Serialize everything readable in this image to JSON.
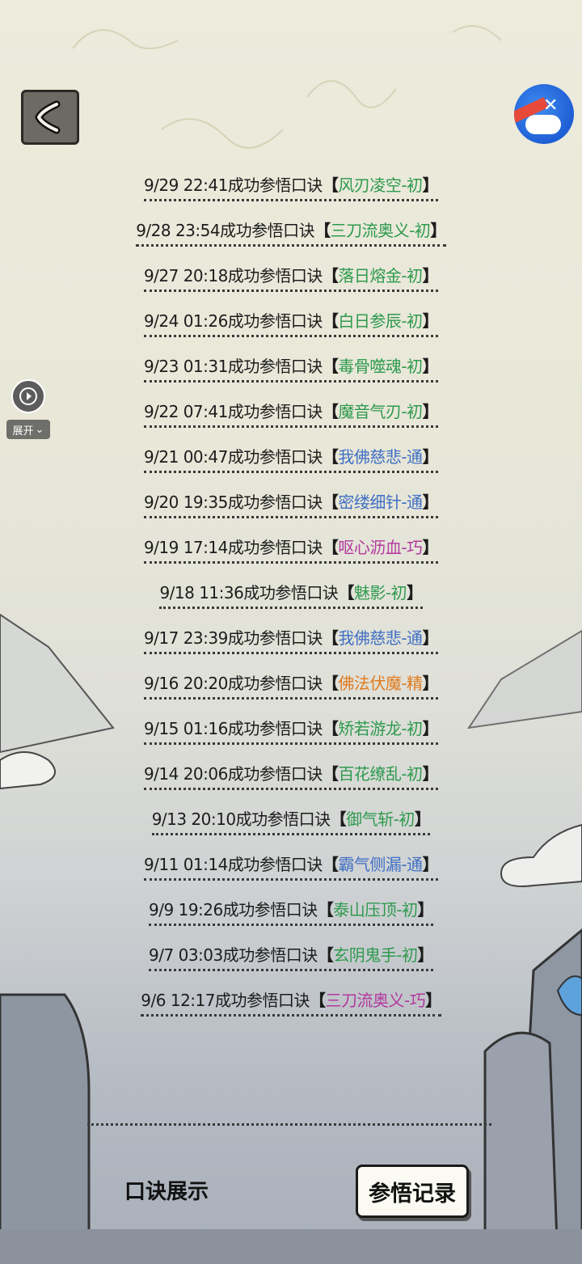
{
  "floating": {
    "expand_label": "展开"
  },
  "records": [
    {
      "time": "9/29 22:41",
      "action": "成功参悟口诀",
      "skill": "风刃凌空-初",
      "color": "#2e9a4e"
    },
    {
      "time": "9/28 23:54",
      "action": "成功参悟口诀",
      "skill": "三刀流奥义-初",
      "color": "#2e9a4e"
    },
    {
      "time": "9/27 20:18",
      "action": "成功参悟口诀",
      "skill": "落日熔金-初",
      "color": "#2e9a4e"
    },
    {
      "time": "9/24 01:26",
      "action": "成功参悟口诀",
      "skill": "白日参辰-初",
      "color": "#2e9a4e"
    },
    {
      "time": "9/23 01:31",
      "action": "成功参悟口诀",
      "skill": "毒骨噬魂-初",
      "color": "#2e9a4e"
    },
    {
      "time": "9/22 07:41",
      "action": "成功参悟口诀",
      "skill": "魔音气刃-初",
      "color": "#2e9a4e"
    },
    {
      "time": "9/21 00:47",
      "action": "成功参悟口诀",
      "skill": "我佛慈悲-通",
      "color": "#3f6fc4"
    },
    {
      "time": "9/20 19:35",
      "action": "成功参悟口诀",
      "skill": "密缕细针-通",
      "color": "#3f6fc4"
    },
    {
      "time": "9/19 17:14",
      "action": "成功参悟口诀",
      "skill": "呕心沥血-巧",
      "color": "#b3389e"
    },
    {
      "time": "9/18 11:36",
      "action": "成功参悟口诀",
      "skill": "魅影-初",
      "color": "#2e9a4e"
    },
    {
      "time": "9/17 23:39",
      "action": "成功参悟口诀",
      "skill": "我佛慈悲-通",
      "color": "#3f6fc4"
    },
    {
      "time": "9/16 20:20",
      "action": "成功参悟口诀",
      "skill": "佛法伏魔-精",
      "color": "#e07a1f"
    },
    {
      "time": "9/15 01:16",
      "action": "成功参悟口诀",
      "skill": "矫若游龙-初",
      "color": "#2e9a4e"
    },
    {
      "time": "9/14 20:06",
      "action": "成功参悟口诀",
      "skill": "百花缭乱-初",
      "color": "#2e9a4e"
    },
    {
      "time": "9/13 20:10",
      "action": "成功参悟口诀",
      "skill": "御气斩-初",
      "color": "#2e9a4e"
    },
    {
      "time": "9/11 01:14",
      "action": "成功参悟口诀",
      "skill": "霸气侧漏-通",
      "color": "#3f6fc4"
    },
    {
      "time": "9/9 19:26",
      "action": "成功参悟口诀",
      "skill": "泰山压顶-初",
      "color": "#2e9a4e"
    },
    {
      "time": "9/7 03:03",
      "action": "成功参悟口诀",
      "skill": "玄阴鬼手-初",
      "color": "#2e9a4e"
    },
    {
      "time": "9/6 12:17",
      "action": "成功参悟口诀",
      "skill": "三刀流奥义-巧",
      "color": "#b3389e"
    }
  ],
  "tabs": {
    "left_label": "口诀展示",
    "right_label": "参悟记录"
  },
  "brackets": {
    "open": "【",
    "close": "】"
  }
}
